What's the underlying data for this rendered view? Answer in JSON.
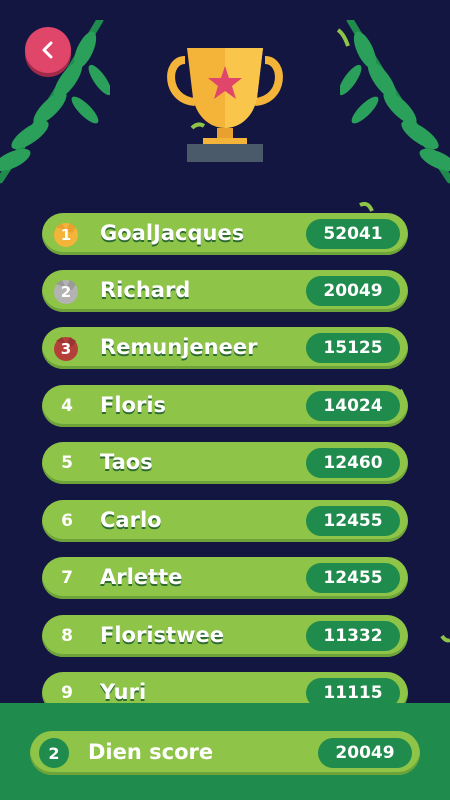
{
  "colors": {
    "background": "#131640",
    "row_green": "#8ec447",
    "score_pill": "#1f8b4c",
    "back_button": "#e0456a",
    "gold": "#f4b339",
    "silver": "#b3b3b3",
    "bronze": "#b5403a"
  },
  "header": {
    "back_icon": "chevron-left-icon",
    "trophy_icon": "trophy-icon"
  },
  "leaderboard": [
    {
      "rank": "1",
      "medal": "gold",
      "name": "GoalJacques",
      "score": "52041"
    },
    {
      "rank": "2",
      "medal": "silver",
      "name": "Richard",
      "score": "20049"
    },
    {
      "rank": "3",
      "medal": "bronze",
      "name": "Remunjeneer",
      "score": "15125"
    },
    {
      "rank": "4",
      "name": "Floris",
      "score": "14024"
    },
    {
      "rank": "5",
      "name": "Taos",
      "score": "12460"
    },
    {
      "rank": "6",
      "name": "Carlo",
      "score": "12455"
    },
    {
      "rank": "7",
      "name": "Arlette",
      "score": "12455"
    },
    {
      "rank": "8",
      "name": "Floristwee",
      "score": "11332"
    },
    {
      "rank": "9",
      "name": "Yuri",
      "score": "11115"
    }
  ],
  "my_score": {
    "rank": "2",
    "label": "Dien score",
    "score": "20049"
  }
}
